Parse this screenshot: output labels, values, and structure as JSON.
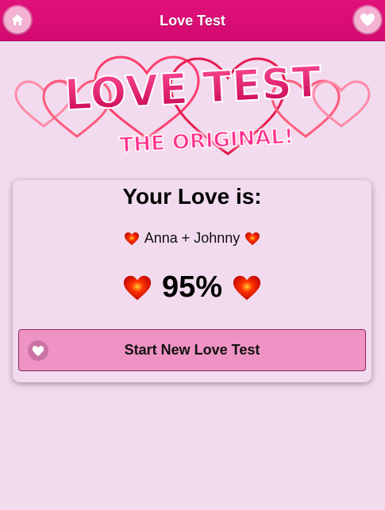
{
  "header": {
    "title": "Love Test",
    "left_icon": "home-icon",
    "right_icon": "heart-icon"
  },
  "logo": {
    "line1": "LOVE TEST",
    "line2": "THE ORIGINAL!"
  },
  "result": {
    "title": "Your Love is:",
    "names": "Anna + Johnny",
    "percent": "95%"
  },
  "button": {
    "label": "Start New Love Test",
    "icon": "heart-icon"
  },
  "colors": {
    "header": "#e0127a",
    "background": "#f2dbee",
    "button": "#ee93c3",
    "heart": "#e0001a"
  }
}
